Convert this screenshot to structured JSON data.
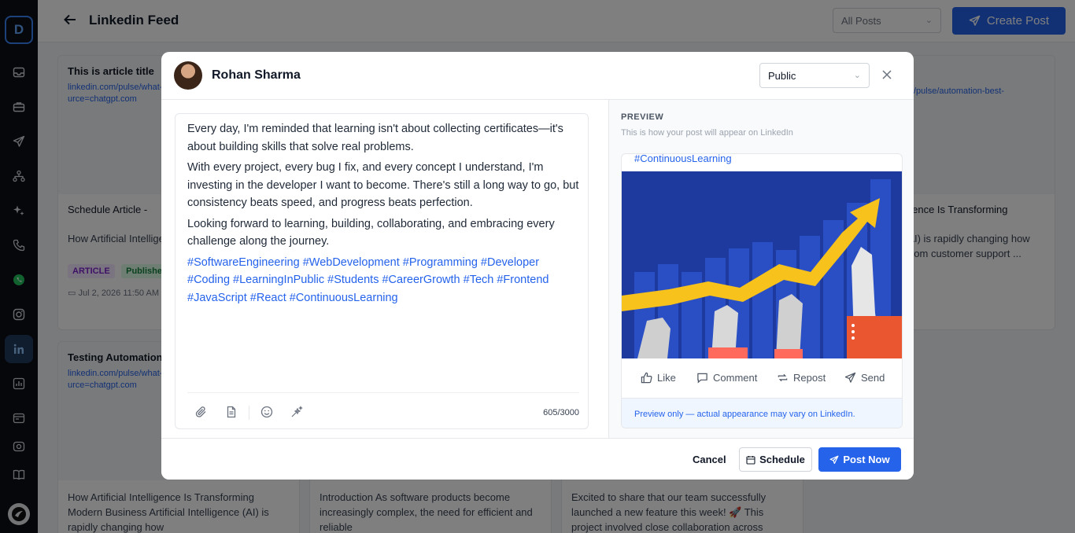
{
  "sidebar": {
    "logo_letter": "D",
    "icons": [
      "inbox-icon",
      "briefcase-icon",
      "send-icon",
      "org-chart-icon",
      "sparkle-icon",
      "phone-icon",
      "whatsapp-icon",
      "instagram-icon",
      "linkedin-icon",
      "chart-icon",
      "file-icon",
      "video-icon",
      "book-icon"
    ]
  },
  "header": {
    "title": "Linkedin Feed",
    "filter_value": "All Posts",
    "create_label": "Create Post"
  },
  "cards": [
    {
      "title": "This is article title",
      "link": "linkedin.com/pulse/what-matters-more-than-you-k utm_source=chatgpt.com",
      "body_title": "Schedule Article -",
      "desc": "How Artificial Intelligen Modern Business...",
      "tag1": "ARTICLE",
      "tag2": "Published",
      "date": "Jul 2, 2026 11:50 AM"
    },
    {
      "title": "Testing Automation",
      "link": "linkedin.com/pulse/what-matters-more-than-you-k utm_source=chatgpt.com",
      "desc": "How Artificial Intelligence Is Transforming Modern Business Artificial Intelligence (AI) is rapidly changing how"
    },
    {
      "desc": "Introduction As software products become increasingly complex, the need for efficient and reliable"
    },
    {
      "desc": "Excited to share that our team successfully launched a new feature this week! 🚀 This project involved close collaboration across"
    },
    {
      "link": "/pulse/automation-best-",
      "body_title": "igence Is Transforming",
      "desc": "(AI) is rapidly changing how From customer support ..."
    }
  ],
  "modal": {
    "author_name": "Rohan Sharma",
    "visibility": "Public",
    "paragraphs": [
      "Every day, I'm reminded that learning isn't about collecting certificates—it's about building skills that solve real problems.",
      "With every project, every bug I fix, and every concept I understand, I'm investing in the developer I want to become. There's still a long way to go, but consistency beats speed, and progress beats perfection.",
      "Looking forward to learning, building, collaborating, and embracing every challenge along the journey."
    ],
    "hashtags": "#SoftwareEngineering #WebDevelopment #Programming #Developer #Coding #LearningInPublic #Students #CareerGrowth #Tech #Frontend #JavaScript #React #ContinuousLearning",
    "char_count": "605/3000",
    "preview": {
      "label": "PREVIEW",
      "subtitle": "This is how your post will appear on LinkedIn",
      "top_hashtag": "#ContinuousLearning",
      "actions": [
        "Like",
        "Comment",
        "Repost",
        "Send"
      ],
      "note": "Preview only — actual appearance may vary on LinkedIn."
    },
    "cancel_label": "Cancel",
    "schedule_label": "Schedule",
    "post_now_label": "Post Now"
  }
}
